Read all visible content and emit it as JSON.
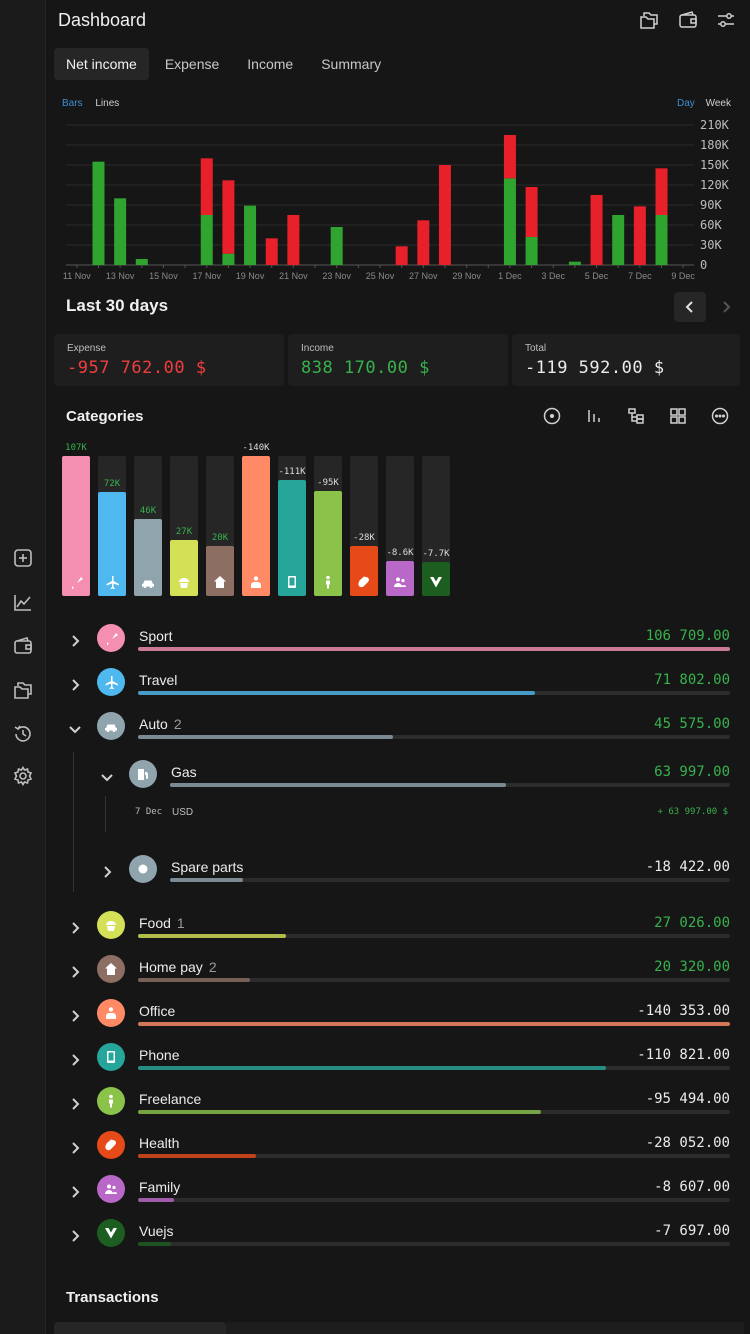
{
  "header": {
    "title": "Dashboard"
  },
  "tabs": [
    {
      "label": "Net income",
      "active": true
    },
    {
      "label": "Expense",
      "active": false
    },
    {
      "label": "Income",
      "active": false
    },
    {
      "label": "Summary",
      "active": false
    }
  ],
  "chart_toggles": {
    "bars": "Bars",
    "lines": "Lines",
    "day": "Day",
    "week": "Week"
  },
  "chart_data": {
    "type": "bar",
    "stacked": true,
    "categories": [
      "11 Nov",
      "12 Nov",
      "13 Nov",
      "14 Nov",
      "15 Nov",
      "16 Nov",
      "17 Nov",
      "18 Nov",
      "19 Nov",
      "20 Nov",
      "21 Nov",
      "22 Nov",
      "23 Nov",
      "24 Nov",
      "25 Nov",
      "26 Nov",
      "27 Nov",
      "28 Nov",
      "29 Nov",
      "30 Nov",
      "1 Dec",
      "2 Dec",
      "3 Dec",
      "4 Dec",
      "5 Dec",
      "6 Dec",
      "7 Dec",
      "8 Dec",
      "9 Dec"
    ],
    "tick_labels": [
      "11 Nov",
      "13 Nov",
      "15 Nov",
      "17 Nov",
      "19 Nov",
      "21 Nov",
      "23 Nov",
      "25 Nov",
      "27 Nov",
      "29 Nov",
      "1 Dec",
      "3 Dec",
      "5 Dec",
      "7 Dec",
      "9 Dec"
    ],
    "series": [
      {
        "color": "#2fa52f",
        "values": [
          0,
          155000,
          100000,
          9000,
          0,
          0,
          75000,
          17000,
          89000,
          0,
          0,
          0,
          57000,
          0,
          0,
          0,
          0,
          0,
          0,
          0,
          130000,
          42000,
          0,
          5000,
          0,
          75000,
          0,
          75000,
          0
        ]
      },
      {
        "color": "#e8202a",
        "values": [
          0,
          0,
          0,
          0,
          0,
          0,
          85000,
          110000,
          0,
          40000,
          75000,
          0,
          0,
          0,
          0,
          28000,
          67000,
          150000,
          0,
          0,
          65000,
          75000,
          0,
          0,
          105000,
          0,
          88000,
          70000,
          0
        ]
      }
    ],
    "y_ticks": [
      "210K",
      "180K",
      "150K",
      "120K",
      "90K",
      "60K",
      "30K",
      "0"
    ],
    "ylim": [
      0,
      210000
    ]
  },
  "period": {
    "title": "Last 30 days"
  },
  "stats": {
    "expense": {
      "label": "Expense",
      "value": "-957 762.00 $"
    },
    "income": {
      "label": "Income",
      "value": "838 170.00 $"
    },
    "total": {
      "label": "Total",
      "value": "-119 592.00 $"
    }
  },
  "categories_title": "Categories",
  "category_columns": [
    {
      "label": "107K",
      "level": 1.0,
      "color": "#f48fb1",
      "positive": true,
      "icon": "badminton-icon"
    },
    {
      "label": "72K",
      "level": 0.74,
      "color": "#4fb8ef",
      "positive": true,
      "icon": "airplane-icon"
    },
    {
      "label": "46K",
      "level": 0.55,
      "color": "#90a4ae",
      "positive": true,
      "icon": "car-icon"
    },
    {
      "label": "27K",
      "level": 0.4,
      "color": "#d4e157",
      "positive": true,
      "icon": "cupcake-icon"
    },
    {
      "label": "20K",
      "level": 0.36,
      "color": "#8d6e63",
      "positive": true,
      "icon": "home-dollar-icon"
    },
    {
      "label": "-140K",
      "level": 1.0,
      "color": "#ff8a65",
      "positive": false,
      "icon": "office-icon"
    },
    {
      "label": "-111K",
      "level": 0.83,
      "color": "#26a69a",
      "positive": false,
      "icon": "phone-icon"
    },
    {
      "label": "-95K",
      "level": 0.75,
      "color": "#8bc34a",
      "positive": false,
      "icon": "person-icon"
    },
    {
      "label": "-28K",
      "level": 0.36,
      "color": "#e64a19",
      "positive": false,
      "icon": "pill-icon"
    },
    {
      "label": "-8.6K",
      "level": 0.25,
      "color": "#ba68c8",
      "positive": false,
      "icon": "family-icon"
    },
    {
      "label": "-7.7K",
      "level": 0.24,
      "color": "#1b5e20",
      "positive": false,
      "icon": "vue-icon"
    }
  ],
  "rows": [
    {
      "name": "Sport",
      "count": "",
      "amount": "106 709.00",
      "positive": true,
      "progress": 1.0,
      "color": "#f48fb1"
    },
    {
      "name": "Travel",
      "count": "",
      "amount": "71 802.00",
      "positive": true,
      "progress": 0.67,
      "color": "#4fb8ef"
    },
    {
      "name": "Auto",
      "count": "2",
      "amount": "45 575.00",
      "positive": true,
      "progress": 0.43,
      "color": "#90a4ae"
    },
    {
      "name": "Gas",
      "count": "",
      "amount": "63 997.00",
      "positive": true,
      "progress": 0.6,
      "color": "#90a4ae"
    },
    {
      "name": "Spare parts",
      "count": "",
      "amount": "-18 422.00",
      "positive": false,
      "progress": 0.13,
      "color": "#90a4ae"
    },
    {
      "name": "Food",
      "count": "1",
      "amount": "27 026.00",
      "positive": true,
      "progress": 0.25,
      "color": "#d4e157"
    },
    {
      "name": "Home pay",
      "count": "2",
      "amount": "20 320.00",
      "positive": true,
      "progress": 0.19,
      "color": "#8d6e63"
    },
    {
      "name": "Office",
      "count": "",
      "amount": "-140 353.00",
      "positive": false,
      "progress": 1.0,
      "color": "#ff8a65"
    },
    {
      "name": "Phone",
      "count": "",
      "amount": "-110 821.00",
      "positive": false,
      "progress": 0.79,
      "color": "#26a69a"
    },
    {
      "name": "Freelance",
      "count": "",
      "amount": "-95 494.00",
      "positive": false,
      "progress": 0.68,
      "color": "#8bc34a"
    },
    {
      "name": "Health",
      "count": "",
      "amount": "-28 052.00",
      "positive": false,
      "progress": 0.2,
      "color": "#e64a19"
    },
    {
      "name": "Family",
      "count": "",
      "amount": "-8 607.00",
      "positive": false,
      "progress": 0.06,
      "color": "#ba68c8"
    },
    {
      "name": "Vuejs",
      "count": "",
      "amount": "-7 697.00",
      "positive": false,
      "progress": 0.055,
      "color": "#1b5e20"
    }
  ],
  "transaction": {
    "date": "7 Dec",
    "currency": "USD",
    "amount": "+ 63 997.00 $"
  },
  "transactions_title": "Transactions",
  "colors": {
    "positive": "#37b24d",
    "negative": "#f03e3e",
    "neutral": "#ececec"
  }
}
